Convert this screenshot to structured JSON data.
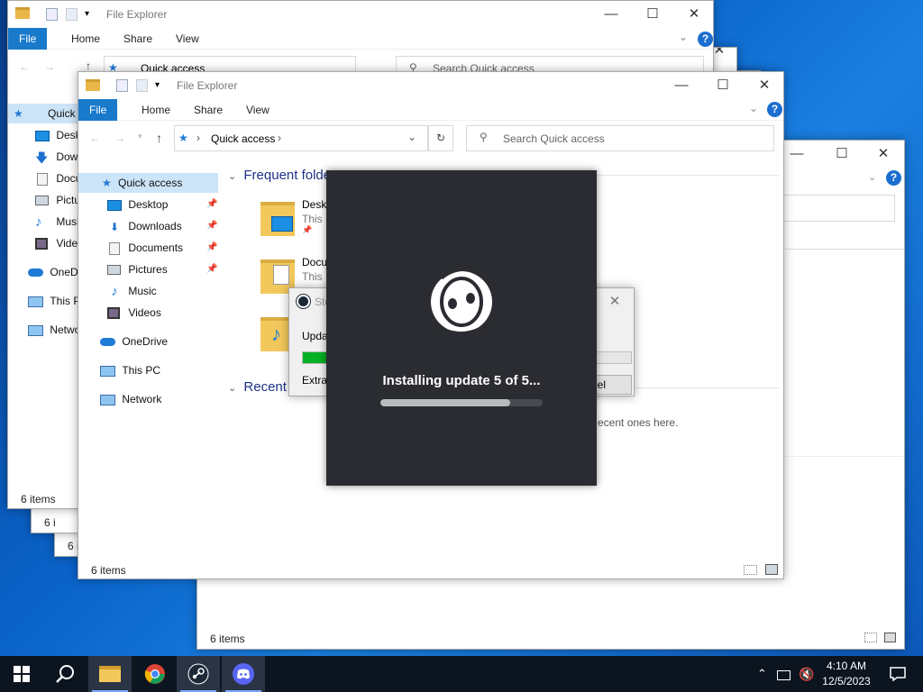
{
  "explorer": {
    "title": "File Explorer",
    "ribbon": {
      "file": "File",
      "home": "Home",
      "share": "Share",
      "view": "View"
    },
    "address": "Quick access",
    "search_placeholder": "Search Quick access",
    "nav": {
      "quick_access": "Quick access",
      "desktop": "Desktop",
      "downloads": "Downloads",
      "documents": "Documents",
      "pictures": "Pictures",
      "music": "Music",
      "videos": "Videos",
      "onedrive": "OneDrive",
      "this_pc": "This PC",
      "network": "Network"
    },
    "frequent_header": "Frequent folde",
    "recent_header": "Recent f",
    "items": [
      {
        "name": "Deskt",
        "sub": "This P"
      },
      {
        "name": "Docu",
        "sub": "This P"
      }
    ],
    "recent_empty_text": "ecent ones here.",
    "status": "6 items"
  },
  "back_window": {
    "nav": {
      "quick_access": "Quick",
      "desktop": "Desk",
      "downloads": "Dow",
      "documents": "Docu",
      "pictures": "Pictu",
      "music": "Musi",
      "videos": "Vide",
      "onedrive": "OneDr",
      "this_pc": "This P",
      "network": "Netwo"
    },
    "stack_items": "6 i"
  },
  "steam_dialog": {
    "title": "Ste",
    "status_text": "Upda",
    "extract_text": "Extra",
    "cancel_label": "ncel",
    "progress": 0.89
  },
  "discord": {
    "status": "Installing update 5 of 5...",
    "progress": 0.8
  },
  "taskbar": {
    "time": "4:10 AM",
    "date": "12/5/2023"
  }
}
